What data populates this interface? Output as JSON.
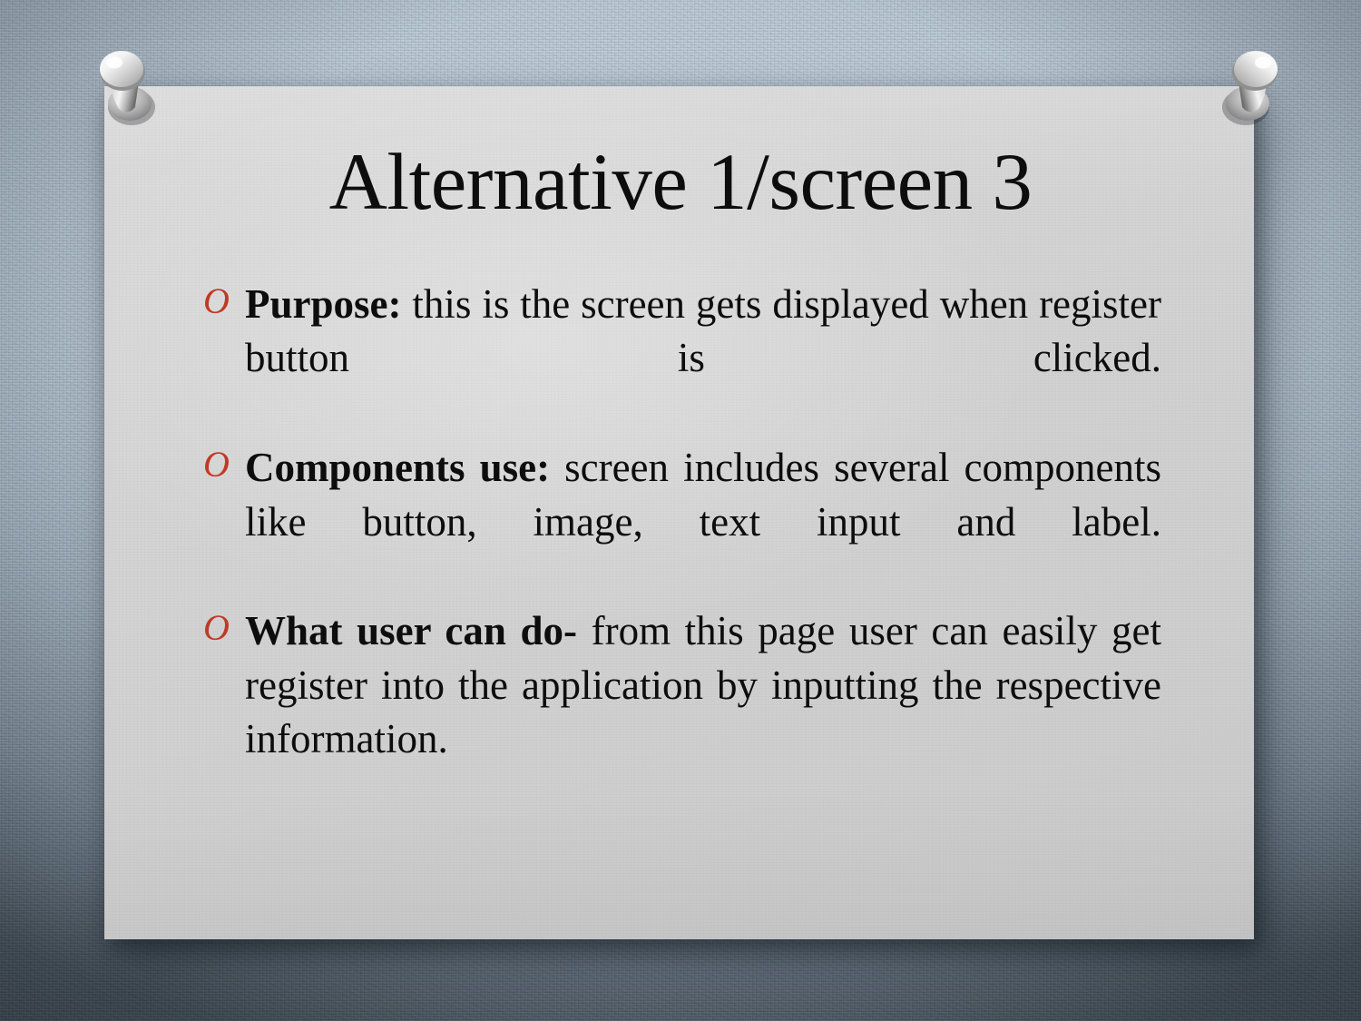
{
  "slide": {
    "title": "Alternative 1/screen 3",
    "theme_name": "pushpin-board",
    "colors": {
      "board": "#d1d1d1",
      "wall_light": "#b7c6d2",
      "wall_dark": "#46515b",
      "bullet_marker": "#bf3a25",
      "body_text": "#0d0d0d",
      "title_text": "#0d0d0d"
    },
    "bullets": [
      {
        "marker": "O",
        "lead": "Purpose:",
        "rest": " this is the screen gets displayed when register button is clicked."
      },
      {
        "marker": "O",
        "lead": "Components use:",
        "rest": " screen includes several components like button, image, text input and label."
      },
      {
        "marker": "O",
        "lead": "What user can do-",
        "rest": " from this page user can easily get register into the application by inputting the respective information."
      }
    ],
    "decorations": {
      "pushpin_left": "pushpin-icon",
      "pushpin_right": "pushpin-icon"
    }
  }
}
